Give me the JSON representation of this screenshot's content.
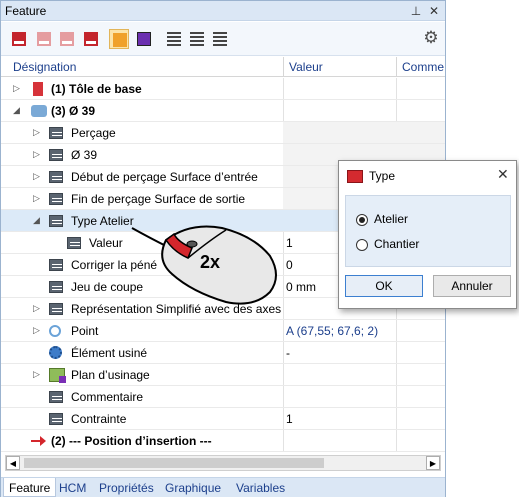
{
  "panel": {
    "title": "Feature",
    "pin_glyph": "⊥",
    "close_glyph": "✕"
  },
  "toolbar": {
    "icons": [
      "sheet-insert-icon",
      "sheet-insert-disabled-icon",
      "sheet-insert-disabled-2-icon",
      "sheet-update-icon",
      "sheet-active-icon",
      "purple-arrow-icon",
      "sort-up-icon",
      "sort-2-icon",
      "sort-down-icon"
    ],
    "settings_glyph": "⚙"
  },
  "columns": {
    "designation": "Désignation",
    "valeur": "Valeur",
    "commentaire": "Comme"
  },
  "rows": [
    {
      "label": "(1) Tôle de base",
      "value": ""
    },
    {
      "label": "(3)  Ø 39",
      "value": ""
    },
    {
      "label": "Perçage",
      "value": ""
    },
    {
      "label": "Ø 39",
      "value": ""
    },
    {
      "label": "Début de perçage Surface d’entrée",
      "value": ""
    },
    {
      "label": "Fin de perçage Surface de sortie",
      "value": ""
    },
    {
      "label": "Type Atelier",
      "value": ""
    },
    {
      "label": "Valeur",
      "value": "1"
    },
    {
      "label": "Corriger la péné",
      "value": "0"
    },
    {
      "label": "Jeu de coupe",
      "value": "0 mm"
    },
    {
      "label": "Représentation  Simplifié avec des axes",
      "value": ""
    },
    {
      "label": "Point",
      "value": "A  (67,55; 67,6; 2)"
    },
    {
      "label": "Élément usiné",
      "value": "-"
    },
    {
      "label": "Plan d’usinage",
      "value": ""
    },
    {
      "label": "Commentaire",
      "value": ""
    },
    {
      "label": "Contrainte",
      "value": "1"
    },
    {
      "label": "(2) --- Position  d’insertion ---",
      "value": ""
    }
  ],
  "mouse_label": "2x",
  "tabs": [
    "Feature",
    "HCM",
    "Propriétés",
    "Graphique",
    "Variables"
  ],
  "dialog": {
    "title": "Type",
    "close_glyph": "✕",
    "options": [
      "Atelier",
      "Chantier"
    ],
    "selected": "Atelier",
    "ok": "OK",
    "cancel": "Annuler"
  },
  "colors": {
    "accent": "#1c3f8c",
    "selection": "#dceaf8",
    "mouse_button": "#d4262c"
  }
}
